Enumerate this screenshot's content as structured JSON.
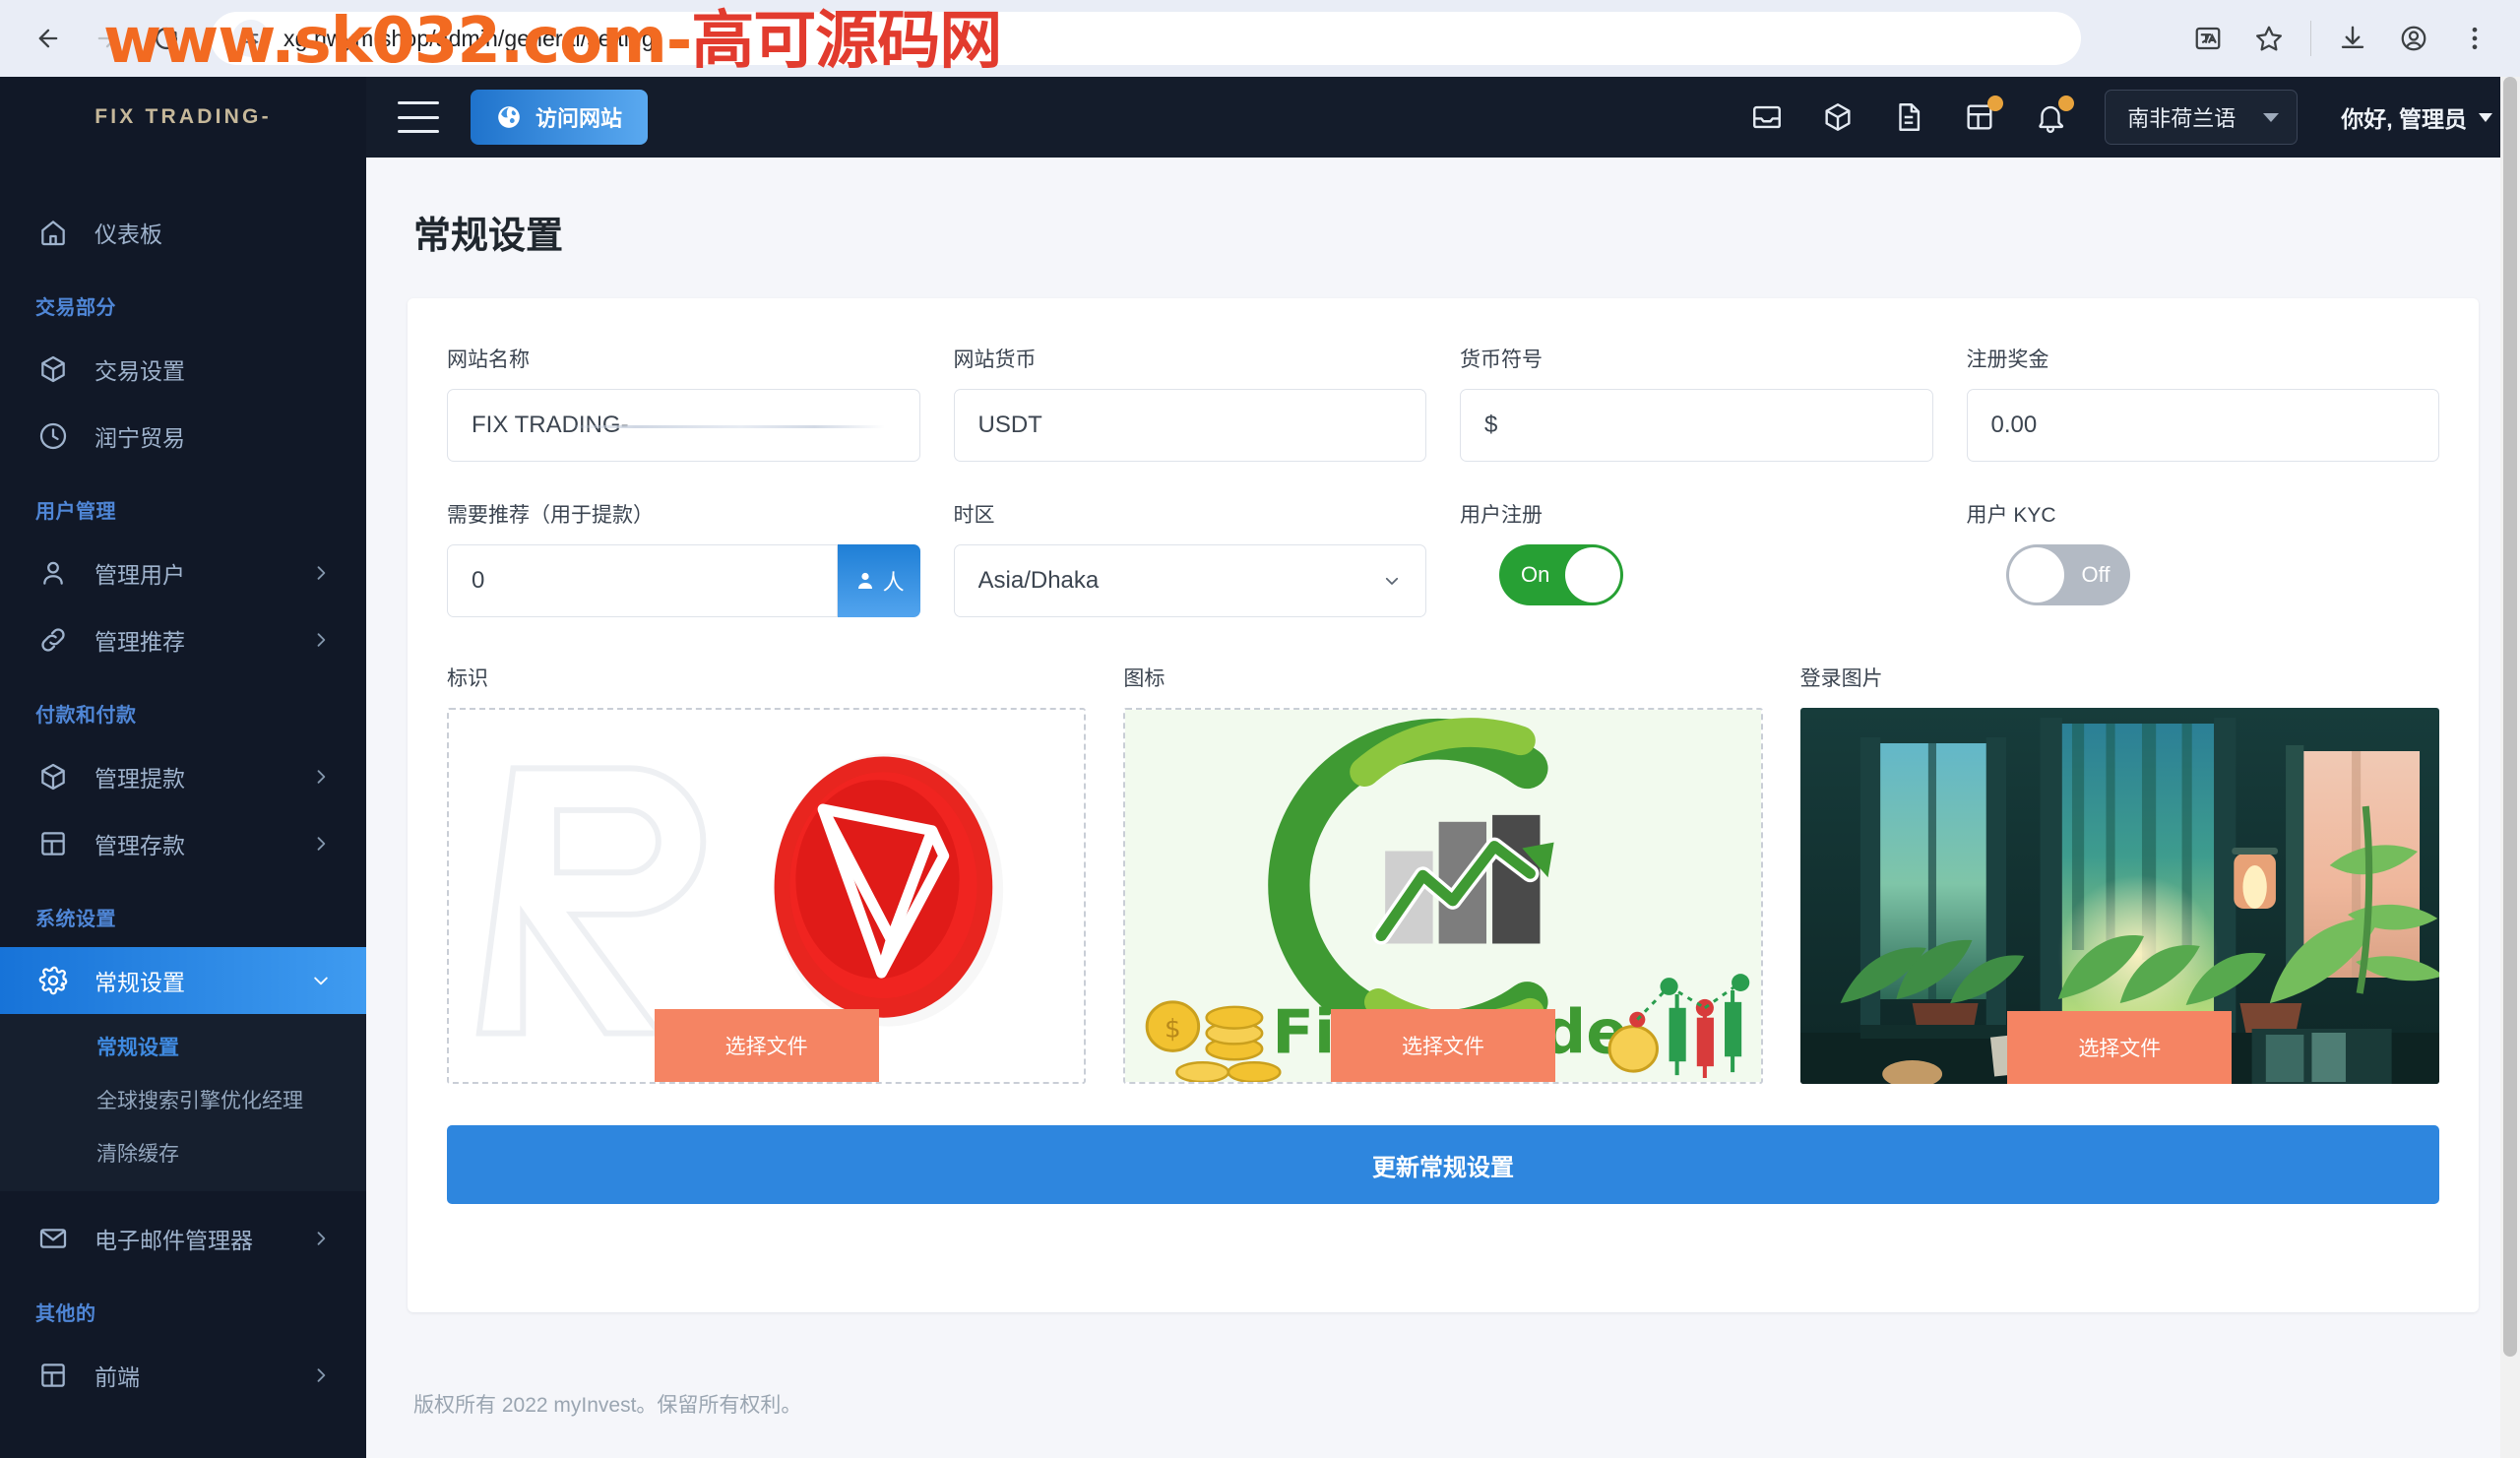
{
  "browser": {
    "url": "xg.hwym.shop/admin/general/setting",
    "watermark_a": "www.sk032.com-",
    "watermark_b": "高可源码网",
    "icons": {
      "back": "back-arrow-icon",
      "forward": "forward-arrow-icon",
      "reload": "reload-icon",
      "site_settings": "site-settings-icon",
      "translate": "translate-icon",
      "bookmark": "star-icon",
      "download": "download-icon",
      "profile": "profile-icon",
      "menu": "kebab-menu-icon"
    }
  },
  "sidebar": {
    "brand": "FIX TRADING-",
    "groups": [
      {
        "title": null,
        "items": [
          {
            "label": "仪表板",
            "icon": "home-icon",
            "has_chevron": false,
            "active": false
          }
        ]
      },
      {
        "title": "交易部分",
        "items": [
          {
            "label": "交易设置",
            "icon": "box-icon",
            "has_chevron": false,
            "active": false
          },
          {
            "label": "润宁贸易",
            "icon": "clock-icon",
            "has_chevron": false,
            "active": false
          }
        ]
      },
      {
        "title": "用户管理",
        "items": [
          {
            "label": "管理用户",
            "icon": "user-icon",
            "has_chevron": true,
            "active": false
          },
          {
            "label": "管理推荐",
            "icon": "link-icon",
            "has_chevron": true,
            "active": false
          }
        ]
      },
      {
        "title": "付款和付款",
        "items": [
          {
            "label": "管理提款",
            "icon": "package-icon",
            "has_chevron": true,
            "active": false
          },
          {
            "label": "管理存款",
            "icon": "layout-icon",
            "has_chevron": true,
            "active": false
          }
        ]
      },
      {
        "title": "系统设置",
        "items": [
          {
            "label": "常规设置",
            "icon": "gear-icon",
            "has_chevron": true,
            "active": true
          }
        ],
        "submenu": [
          {
            "label": "常规设置",
            "active": true
          },
          {
            "label": "全球搜索引擎优化经理",
            "active": false
          },
          {
            "label": "清除缓存",
            "active": false
          }
        ]
      },
      {
        "title": null,
        "items": [
          {
            "label": "电子邮件管理器",
            "icon": "mail-icon",
            "has_chevron": true,
            "active": false
          }
        ]
      },
      {
        "title": "其他的",
        "items": [
          {
            "label": "前端",
            "icon": "layout-icon",
            "has_chevron": true,
            "active": false
          }
        ]
      }
    ]
  },
  "topbar": {
    "menu_toggle": "hamburger-icon",
    "visit_site_label": "访问网站",
    "visit_site_icon": "globe-icon",
    "icons": [
      {
        "name": "inbox-icon",
        "badge": false
      },
      {
        "name": "package-icon",
        "badge": false
      },
      {
        "name": "document-icon",
        "badge": false
      },
      {
        "name": "layout-icon",
        "badge": true
      },
      {
        "name": "bell-icon",
        "badge": true
      }
    ],
    "language": "南非荷兰语",
    "user_greeting": "你好, 管理员"
  },
  "page": {
    "title": "常规设置",
    "fields": {
      "site_name": {
        "label": "网站名称",
        "value": "FIX TRADING-"
      },
      "site_currency": {
        "label": "网站货币",
        "value": "USDT"
      },
      "currency_symbol": {
        "label": "货币符号",
        "value": "$"
      },
      "signup_bonus": {
        "label": "注册奖金",
        "value": "0.00"
      },
      "referral_needed": {
        "label": "需要推荐（用于提款）",
        "value": "0",
        "addon_label": "人",
        "addon_icon": "user-icon"
      },
      "timezone": {
        "label": "时区",
        "value": "Asia/Dhaka",
        "options": [
          "Asia/Dhaka"
        ]
      },
      "user_registration": {
        "label": "用户注册",
        "state": "On",
        "enabled": true
      },
      "user_kyc": {
        "label": "用户 KYC",
        "state": "Off",
        "enabled": false
      }
    },
    "uploads": [
      {
        "label": "标识",
        "button": "选择文件",
        "preview": "tron-logo-preview"
      },
      {
        "label": "图标",
        "button": "选择文件",
        "preview": "green-chart-logo-preview"
      },
      {
        "label": "登录图片",
        "button": "选择文件",
        "preview": "indoor-plants-photo-preview"
      }
    ],
    "submit_label": "更新常规设置",
    "footer": "版权所有 2022 myInvest。保留所有权利。"
  },
  "colors": {
    "sidebar_bg": "#111827",
    "accent_blue": "#2e86de",
    "active_gradient_start": "#1773d8",
    "active_gradient_end": "#3f9bf0",
    "toggle_on": "#27a034",
    "toggle_off": "#b3bac4",
    "choose_file_orange": "#f58463",
    "section_label_blue": "#4f86d6"
  }
}
